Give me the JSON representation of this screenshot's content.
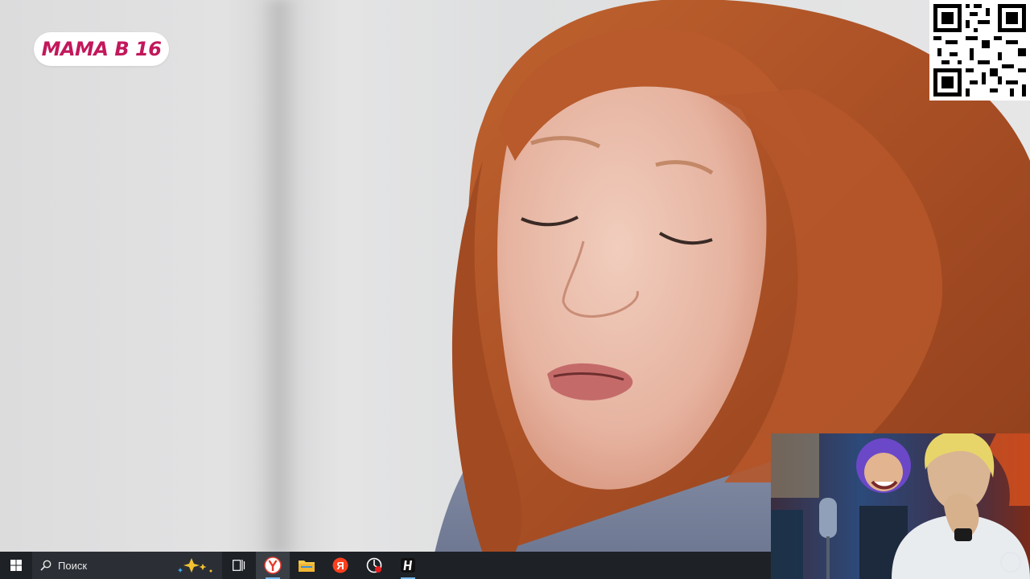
{
  "video": {
    "show_logo": "МАМА В 16"
  },
  "taskbar": {
    "search_label": "Поиск",
    "icons": {
      "start": "windows-start-icon",
      "search": "search-icon",
      "sparkle": "sparkle-icon",
      "task_view": "task-view-icon",
      "yandex_browser": "yandex-browser-icon",
      "file_explorer": "folder-icon",
      "yandex": "yandex-icon",
      "obs": "record-icon",
      "app_h": "h-app-icon"
    },
    "colors": {
      "background": "#1e2227",
      "search_bg": "#2b2f35",
      "active_indicator": "#76b9ed"
    }
  },
  "colors": {
    "logo_text": "#c2185b",
    "hair": "#b5562a"
  }
}
